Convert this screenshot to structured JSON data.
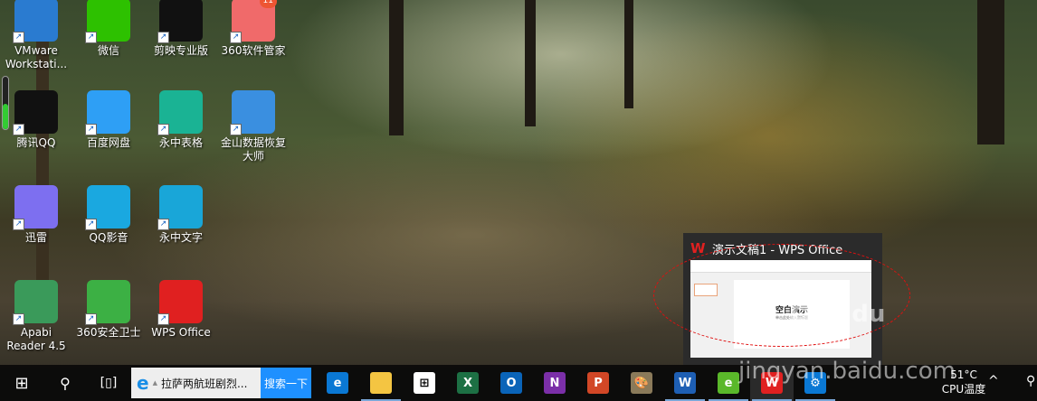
{
  "desktop": {
    "icons": [
      {
        "label": "VMware Workstati...",
        "icon": "vmware-icon",
        "color": "#2a7bd0",
        "col": 0,
        "row": 0
      },
      {
        "label": "微信",
        "icon": "wechat-icon",
        "color": "#2dc100",
        "col": 1,
        "row": 0
      },
      {
        "label": "剪映专业版",
        "icon": "jianying-icon",
        "color": "#111111",
        "col": 2,
        "row": 0
      },
      {
        "label": "360软件管家",
        "icon": "360-software-manager-icon",
        "color": "#f06a6a",
        "col": 3,
        "row": 0,
        "badge": "11"
      },
      {
        "label": "腾讯QQ",
        "icon": "qq-icon",
        "color": "#111111",
        "col": 0,
        "row": 1
      },
      {
        "label": "百度网盘",
        "icon": "baidu-netdisk-icon",
        "color": "#2e9ff5",
        "col": 1,
        "row": 1
      },
      {
        "label": "永中表格",
        "icon": "yozo-sheet-icon",
        "color": "#1ab394",
        "col": 2,
        "row": 1
      },
      {
        "label": "金山数据恢复大师",
        "icon": "kingsoft-recovery-icon",
        "color": "#3a8fe0",
        "col": 3,
        "row": 1
      },
      {
        "label": "迅雷",
        "icon": "xunlei-icon",
        "color": "#7d6ff0",
        "col": 0,
        "row": 2
      },
      {
        "label": "QQ影音",
        "icon": "qq-player-icon",
        "color": "#1aa8e0",
        "col": 1,
        "row": 2
      },
      {
        "label": "永中文字",
        "icon": "yozo-writer-icon",
        "color": "#19a6d8",
        "col": 2,
        "row": 2
      },
      {
        "label": "Apabi Reader 4.5",
        "icon": "apabi-reader-icon",
        "color": "#3a9a5a",
        "col": 0,
        "row": 3
      },
      {
        "label": "360安全卫士",
        "icon": "360-safe-icon",
        "color": "#3cb044",
        "col": 1,
        "row": 3
      },
      {
        "label": "WPS Office",
        "icon": "wps-office-icon",
        "color": "#e02020",
        "col": 2,
        "row": 3
      }
    ]
  },
  "taskbar": {
    "search_text": "拉萨两航班剧烈...",
    "search_button": "搜索一下",
    "apps": [
      {
        "name": "edge",
        "icon": "edge-icon",
        "glyph": "e",
        "color": "#0a78d4"
      },
      {
        "name": "file-explorer",
        "icon": "folder-icon",
        "glyph": "",
        "color": "#f4c542",
        "running": true
      },
      {
        "name": "store",
        "icon": "store-icon",
        "glyph": "⊞",
        "color": "#ffffff"
      },
      {
        "name": "excel",
        "icon": "excel-icon",
        "glyph": "X",
        "color": "#1d7044"
      },
      {
        "name": "outlook",
        "icon": "outlook-icon",
        "glyph": "O",
        "color": "#0a64b8"
      },
      {
        "name": "onenote",
        "icon": "onenote-icon",
        "glyph": "N",
        "color": "#7b2fa8"
      },
      {
        "name": "powerpoint",
        "icon": "powerpoint-icon",
        "glyph": "P",
        "color": "#d24726"
      },
      {
        "name": "paint",
        "icon": "paint-palette-icon",
        "glyph": "🎨",
        "color": "#8a7a5a"
      },
      {
        "name": "word",
        "icon": "word-icon",
        "glyph": "W",
        "color": "#1e5fb4",
        "running": true
      },
      {
        "name": "360-browser",
        "icon": "360-browser-icon",
        "glyph": "e",
        "color": "#5ab82a",
        "running": true
      },
      {
        "name": "wps-office",
        "icon": "wps-icon",
        "glyph": "W",
        "color": "#e02020",
        "running": true,
        "active": true
      },
      {
        "name": "settings",
        "icon": "gear-icon",
        "glyph": "⚙",
        "color": "#0a78d4",
        "running": true
      }
    ],
    "tray": {
      "temp": "51°C",
      "temp_label": "CPU温度"
    }
  },
  "preview": {
    "title": "演示文稿1 - WPS Office",
    "slide_title": "空白演示",
    "slide_subtitle": "单击此处输入副标题"
  },
  "watermark": "jingyan.baidu.com",
  "watermark_logo": "Baidu 经验"
}
